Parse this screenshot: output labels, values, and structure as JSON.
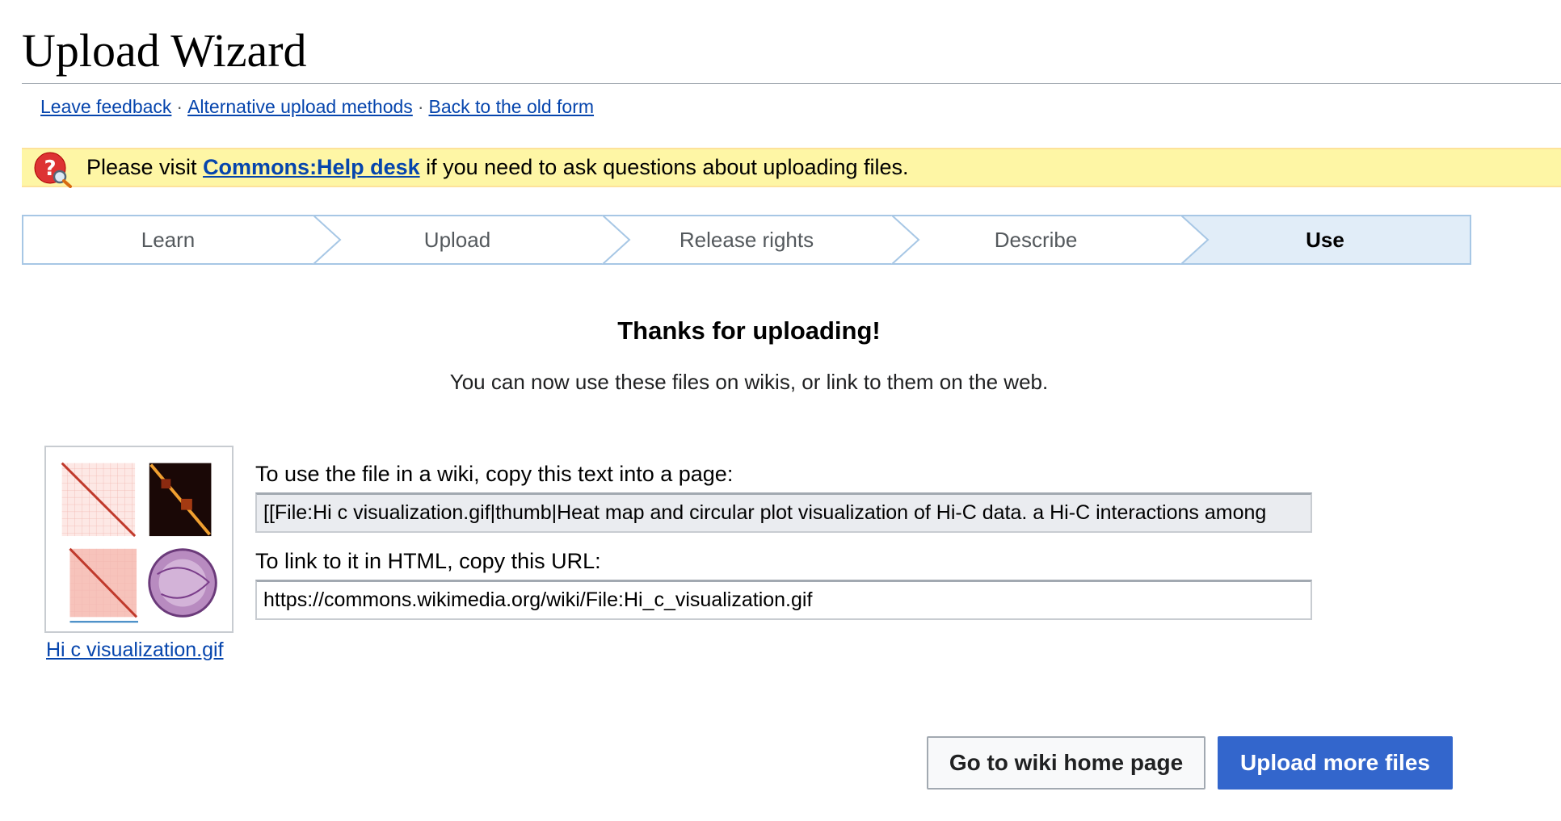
{
  "page": {
    "title": "Upload Wizard"
  },
  "links": {
    "feedback": "Leave feedback",
    "alternative": "Alternative upload methods",
    "old_form": "Back to the old form",
    "separator": "·"
  },
  "notice": {
    "prefix": "Please visit ",
    "link": "Commons:Help desk",
    "suffix": " if you need to ask questions about uploading files.",
    "icon": "help-question-icon"
  },
  "steps": {
    "items": [
      {
        "label": "Learn"
      },
      {
        "label": "Upload"
      },
      {
        "label": "Release rights"
      },
      {
        "label": "Describe"
      },
      {
        "label": "Use"
      }
    ],
    "active": "Use"
  },
  "thanks": {
    "title": "Thanks for uploading!",
    "subtitle": "You can now use these files on wikis, or link to them on the web."
  },
  "file": {
    "name": "Hi c visualization.gif",
    "wiki_label": "To use the file in a wiki, copy this text into a page:",
    "wiki_text": "[[File:Hi c visualization.gif|thumb|Heat map and circular plot visualization of Hi-C data. a Hi-C interactions among",
    "html_label": "To link to it in HTML, copy this URL:",
    "url": "https://commons.wikimedia.org/wiki/File:Hi_c_visualization.gif"
  },
  "buttons": {
    "home": "Go to wiki home page",
    "more": "Upload more files"
  },
  "colors": {
    "link": "#0645ad",
    "notice_bg": "#fef6a5",
    "step_active_bg": "#e1edf8",
    "primary_button": "#3366cc"
  }
}
